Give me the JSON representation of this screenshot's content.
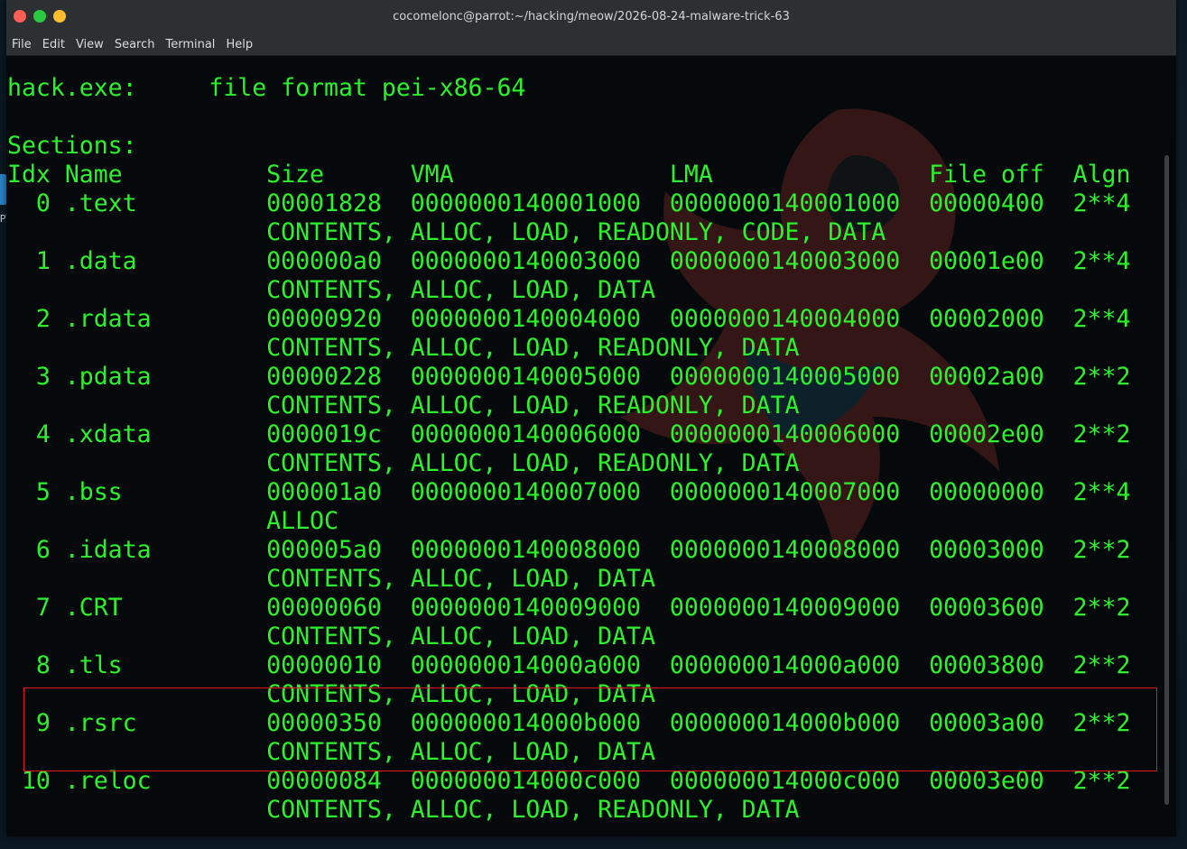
{
  "window": {
    "title": "cocomelonc@parrot:~/hacking/meow/2026-08-24-malware-trick-63"
  },
  "menu": [
    "File",
    "Edit",
    "View",
    "Search",
    "Terminal",
    "Help"
  ],
  "desktop": {
    "icon_label": "/PT-files"
  },
  "terminal": {
    "lines": [
      "hack.exe:     file format pei-x86-64",
      "",
      "Sections:",
      "Idx Name          Size      VMA               LMA               File off  Algn",
      "  0 .text         00001828  0000000140001000  0000000140001000  00000400  2**4",
      "                  CONTENTS, ALLOC, LOAD, READONLY, CODE, DATA",
      "  1 .data         000000a0  0000000140003000  0000000140003000  00001e00  2**4",
      "                  CONTENTS, ALLOC, LOAD, DATA",
      "  2 .rdata        00000920  0000000140004000  0000000140004000  00002000  2**4",
      "                  CONTENTS, ALLOC, LOAD, READONLY, DATA",
      "  3 .pdata        00000228  0000000140005000  0000000140005000  00002a00  2**2",
      "                  CONTENTS, ALLOC, LOAD, READONLY, DATA",
      "  4 .xdata        0000019c  0000000140006000  0000000140006000  00002e00  2**2",
      "                  CONTENTS, ALLOC, LOAD, READONLY, DATA",
      "  5 .bss          000001a0  0000000140007000  0000000140007000  00000000  2**4",
      "                  ALLOC",
      "  6 .idata        000005a0  0000000140008000  0000000140008000  00003000  2**2",
      "                  CONTENTS, ALLOC, LOAD, DATA",
      "  7 .CRT          00000060  0000000140009000  0000000140009000  00003600  2**2",
      "                  CONTENTS, ALLOC, LOAD, DATA",
      "  8 .tls          00000010  000000014000a000  000000014000a000  00003800  2**2",
      "                  CONTENTS, ALLOC, LOAD, DATA",
      "  9 .rsrc         00000350  000000014000b000  000000014000b000  00003a00  2**2",
      "                  CONTENTS, ALLOC, LOAD, DATA",
      " 10 .reloc        00000084  000000014000c000  000000014000c000  00003e00  2**2",
      "                  CONTENTS, ALLOC, LOAD, READONLY, DATA"
    ]
  },
  "colors": {
    "terminal_text": "#2cf12c",
    "highlight": "#e0141b"
  }
}
